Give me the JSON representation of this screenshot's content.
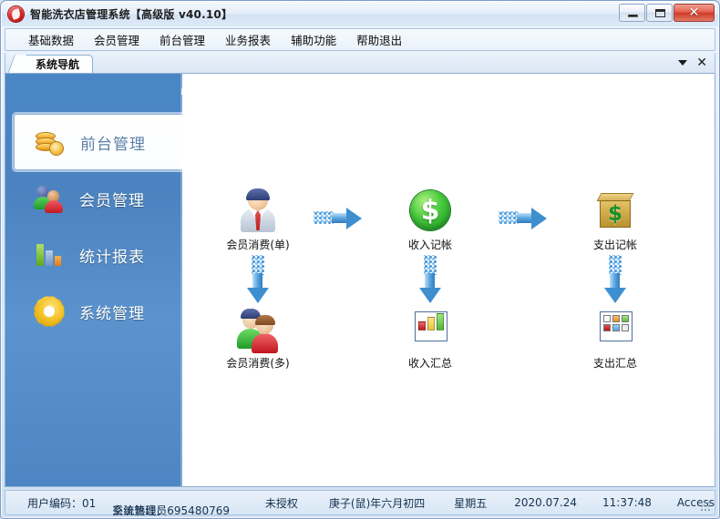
{
  "window": {
    "title": "智能洗衣店管理系统【高级版 v40.10】",
    "app_icon": "flame-logo-icon",
    "buttons": {
      "minimize": "minimize-icon",
      "maximize": "maximize-icon",
      "close": "✕"
    }
  },
  "menubar": {
    "items": [
      {
        "label": "基础数据"
      },
      {
        "label": "会员管理"
      },
      {
        "label": "前台管理"
      },
      {
        "label": "业务报表"
      },
      {
        "label": "辅助功能"
      },
      {
        "label": "帮助退出"
      }
    ]
  },
  "tabs": {
    "active": "系统导航",
    "items": [
      {
        "label": "系统导航"
      }
    ],
    "tools": {
      "dropdown": "chevron-down-icon",
      "close": "✕"
    }
  },
  "sidebar": {
    "items": [
      {
        "label": "前台管理",
        "icon": "coins-icon",
        "active": true
      },
      {
        "label": "会员管理",
        "icon": "two-people-icon",
        "active": false
      },
      {
        "label": "统计报表",
        "icon": "bar-chart-icon",
        "active": false
      },
      {
        "label": "系统管理",
        "icon": "gear-icon",
        "active": false
      }
    ]
  },
  "flow": {
    "nodes": [
      {
        "label": "会员消费(单)",
        "icon": "person-single-icon"
      },
      {
        "label": "收入记帐",
        "icon": "green-dollar-coin-icon"
      },
      {
        "label": "支出记帐",
        "icon": "gold-box-dollar-icon"
      },
      {
        "label": "会员消费(多)",
        "icon": "person-multi-icon"
      },
      {
        "label": "收入汇总",
        "icon": "bar-chart-window-icon"
      },
      {
        "label": "支出汇总",
        "icon": "grid-window-icon"
      }
    ],
    "connectors": [
      {
        "type": "arrow-right-icon"
      },
      {
        "type": "arrow-right-icon"
      },
      {
        "type": "arrow-down-icon"
      },
      {
        "type": "arrow-down-icon"
      },
      {
        "type": "arrow-down-icon"
      }
    ]
  },
  "statusbar": {
    "user_code": "用户编码：01",
    "role": "系统管理员",
    "hotline": "交流热线：695480769",
    "license": "未授权",
    "lunar_date": "庚子(鼠)年六月初四",
    "weekday": "星期五",
    "date": "2020.07.24",
    "time": "11:37:48",
    "database": "Access"
  },
  "colors": {
    "sidebar_blue": "#4a86c5",
    "accent_blue": "#3e8fd0",
    "active_text": "#5b7fa6",
    "close_red": "#cf3a27"
  }
}
